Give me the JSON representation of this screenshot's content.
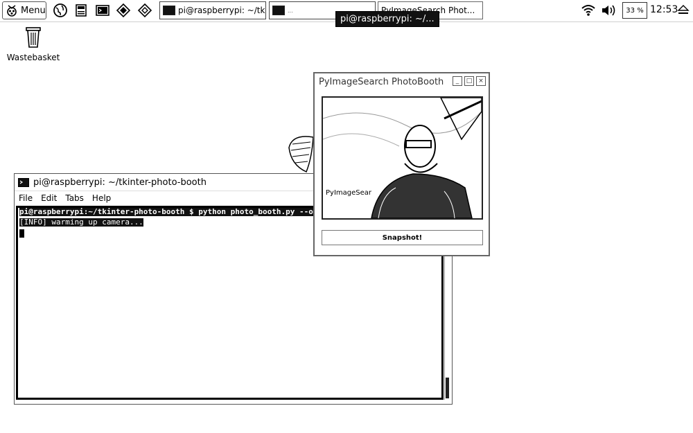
{
  "taskbar": {
    "menu_label": "Menu",
    "tasks": [
      {
        "label": "pi@raspberrypi: ~/tki..."
      },
      {
        "label": "..."
      },
      {
        "label": "PyImageSearch Phot..."
      }
    ],
    "tooltip": "pi@raspberrypi: ~/...",
    "cpu_label": "33 %",
    "clock": "12:53"
  },
  "desktop": {
    "wastebasket_label": "Wastebasket"
  },
  "terminal": {
    "title": "pi@raspberrypi: ~/tkinter-photo-booth",
    "menu": [
      "File",
      "Edit",
      "Tabs",
      "Help"
    ],
    "lines": [
      "pi@raspberrypi:~/tkinter-photo-booth $ python photo_booth.py --output",
      "[INFO] warming up camera..."
    ]
  },
  "photobooth": {
    "title": "PyImageSearch PhotoBooth",
    "caption": "PyImageSear",
    "snapshot_label": "Snapshot!"
  }
}
